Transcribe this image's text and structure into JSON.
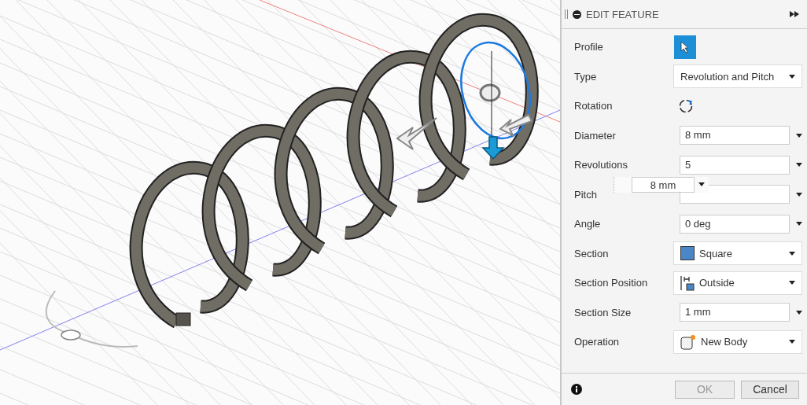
{
  "panel": {
    "title": "EDIT FEATURE",
    "rows": [
      {
        "label": "Profile",
        "kind": "pick",
        "active": true
      },
      {
        "label": "Type",
        "kind": "select",
        "value": "Revolution and Pitch"
      },
      {
        "label": "Rotation",
        "kind": "rotate"
      },
      {
        "label": "Diameter",
        "kind": "input",
        "value": "8 mm"
      },
      {
        "label": "Revolutions",
        "kind": "input",
        "value": "5"
      },
      {
        "label": "Pitch",
        "kind": "input"
      },
      {
        "label": "Angle",
        "kind": "input",
        "value": "0 deg"
      },
      {
        "label": "Section",
        "kind": "select",
        "value": "Square"
      },
      {
        "label": "Section Position",
        "kind": "select",
        "value": "Outside"
      },
      {
        "label": "Section Size",
        "kind": "input",
        "value": "1 mm"
      },
      {
        "label": "Operation",
        "kind": "select",
        "value": "New Body"
      }
    ],
    "floating_input": {
      "value": "8 mm"
    },
    "buttons": [
      {
        "label": "OK",
        "disabled": true
      },
      {
        "label": "Cancel",
        "disabled": false
      }
    ]
  }
}
